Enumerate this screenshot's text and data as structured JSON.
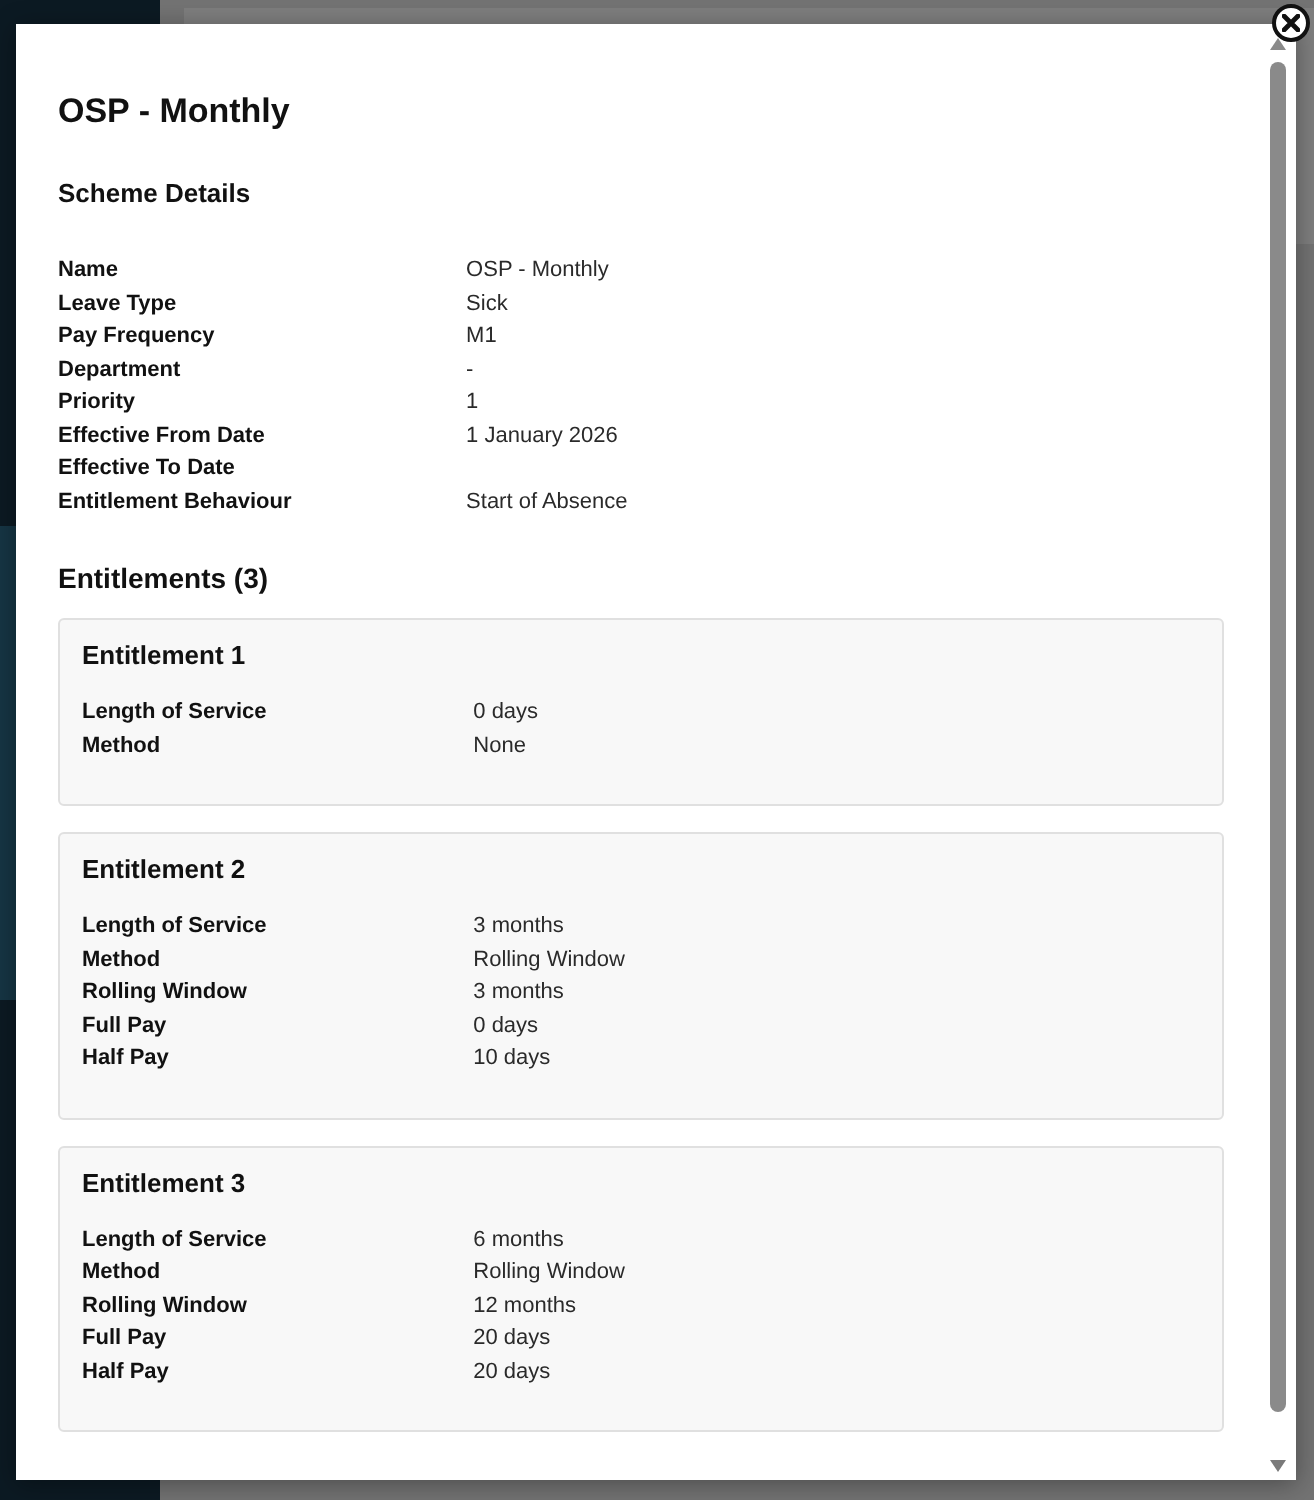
{
  "modal": {
    "title": "OSP - Monthly",
    "scheme_details": {
      "heading": "Scheme Details",
      "fields": [
        {
          "label": "Name",
          "value": "OSP - Monthly"
        },
        {
          "label": "Leave Type",
          "value": "Sick"
        },
        {
          "label": "Pay Frequency",
          "value": "M1"
        },
        {
          "label": "Department",
          "value": "-"
        },
        {
          "label": "Priority",
          "value": "1"
        },
        {
          "label": "Effective From Date",
          "value": "1 January 2026"
        },
        {
          "label": "Effective To Date"
        },
        {
          "label": "Entitlement Behaviour",
          "value": "Start of Absence"
        }
      ]
    },
    "entitlements": {
      "heading": "Entitlements (3)",
      "items": [
        {
          "title": "Entitlement 1",
          "fields": [
            {
              "label": "Length of Service",
              "value": "0 days"
            },
            {
              "label": "Method",
              "value": "None"
            }
          ]
        },
        {
          "title": "Entitlement 2",
          "fields": [
            {
              "label": "Length of Service",
              "value": "3 months"
            },
            {
              "label": "Method",
              "value": "Rolling Window"
            },
            {
              "label": "Rolling Window",
              "value": "3 months"
            },
            {
              "label": "Full Pay",
              "value": "0 days"
            },
            {
              "label": "Half Pay",
              "value": "10 days"
            }
          ]
        },
        {
          "title": "Entitlement 3",
          "fields": [
            {
              "label": "Length of Service",
              "value": "6 months"
            },
            {
              "label": "Method",
              "value": "Rolling Window"
            },
            {
              "label": "Rolling Window",
              "value": "12 months"
            },
            {
              "label": "Full Pay",
              "value": "20 days"
            },
            {
              "label": "Half Pay",
              "value": "20 days"
            }
          ]
        }
      ]
    }
  }
}
